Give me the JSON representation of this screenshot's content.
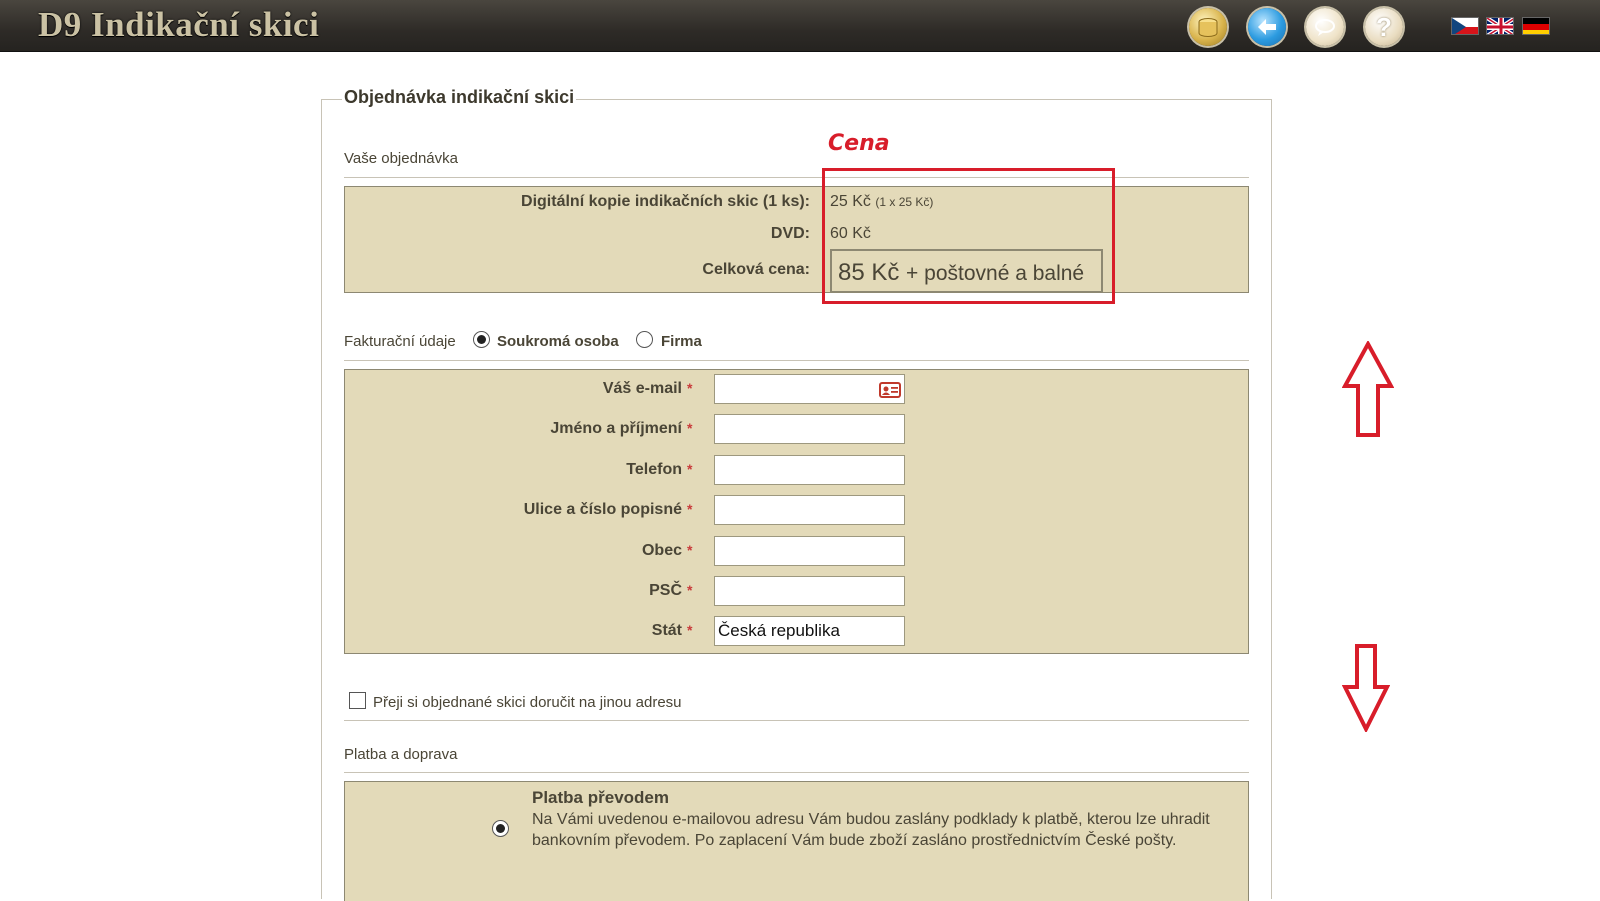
{
  "header": {
    "title": "D9 Indikační skici",
    "buttons": [
      {
        "icon": "coins-icon"
      },
      {
        "icon": "back-arrow-icon"
      },
      {
        "icon": "chat-icon"
      },
      {
        "icon": "help-icon",
        "glyph": "?"
      }
    ],
    "languages": [
      "cz",
      "uk",
      "de"
    ]
  },
  "form": {
    "legend": "Objednávka indikační skici",
    "order_section": {
      "label": "Vaše objednávka",
      "rows": [
        {
          "label": "Digitální kopie indikačních skic (1 ks):",
          "value": "25 Kč",
          "note": "(1 x 25 Kč)"
        },
        {
          "label": "DVD:",
          "value": "60 Kč"
        },
        {
          "label": "Celková cena:",
          "value": "85 Kč",
          "suffix": "+ poštovné a balné"
        }
      ]
    },
    "billing_section": {
      "label": "Fakturační údaje",
      "options": [
        {
          "label": "Soukromá osoba",
          "selected": true
        },
        {
          "label": "Firma",
          "selected": false
        }
      ],
      "required_mark": "*",
      "fields": [
        {
          "label": "Váš e-mail",
          "value": ""
        },
        {
          "label": "Jméno a příjmení",
          "value": ""
        },
        {
          "label": "Telefon",
          "value": ""
        },
        {
          "label": "Ulice a číslo popisné",
          "value": ""
        },
        {
          "label": "Obec",
          "value": ""
        },
        {
          "label": "PSČ",
          "value": ""
        },
        {
          "label": "Stát",
          "value": "Česká republika"
        }
      ]
    },
    "other_address": {
      "label": "Přeji si objednané skici doručit na jinou adresu",
      "checked": false
    },
    "payment_section": {
      "label": "Platba a doprava",
      "option": {
        "title": "Platba převodem",
        "description": "Na Vámi uvedenou e-mailovou adresu Vám budou zaslány podklady k platbě, kterou lze uhradit bankovním převodem. Po zaplacení Vám bude zboží zasláno prostřednictvím České pošty.",
        "selected": true
      }
    }
  },
  "annotations": {
    "price_label": "Cena",
    "arrows": [
      "up",
      "down"
    ],
    "color": "#d81d2a"
  },
  "colors": {
    "header_bg": "#2e2b27",
    "panel_bg": "#e3dab9",
    "title_text": "#cbc2a4",
    "required": "#c83a3a"
  }
}
